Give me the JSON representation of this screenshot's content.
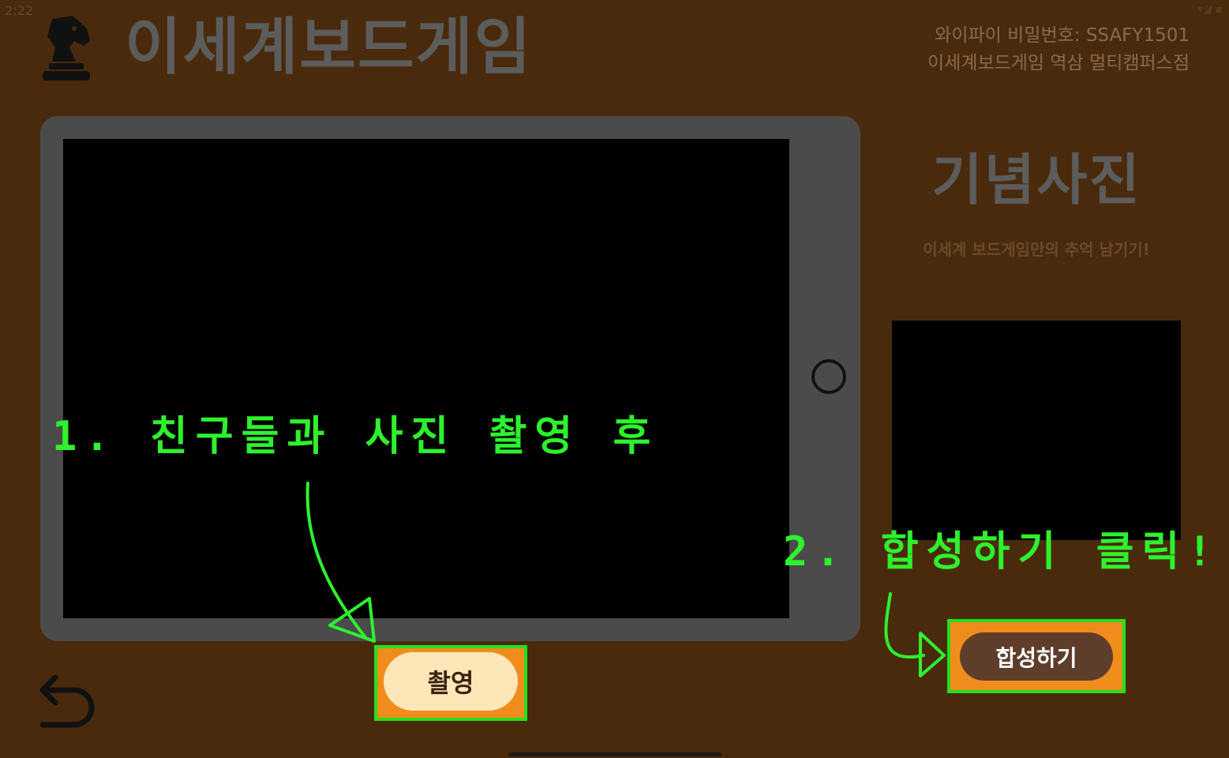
{
  "status": {
    "time": "2:22",
    "icons": "▾◢ ▪"
  },
  "header": {
    "title": "이세계보드게임",
    "wifi_line": "와이파이 비밀번호: SSAFY1501",
    "store_line": "이세계보드게임 역삼 멀티캠퍼스점"
  },
  "panel": {
    "title": "기념사진",
    "subtitle": "이세계 보드게임만의 추억 남기기!"
  },
  "buttons": {
    "shoot_label": "촬영",
    "compose_label": "합성하기"
  },
  "annotations": {
    "step1": "1. 친구들과 사진 촬영 후",
    "step2": "2. 합성하기 클릭!"
  },
  "colors": {
    "background": "#4a2a0d",
    "highlight_fill": "#f08c1c",
    "highlight_border": "#22e01c",
    "annotation": "#2df22d"
  },
  "icons": {
    "logo": "chess-knight-icon",
    "back": "undo-arrow-icon",
    "home": "home-button-icon"
  }
}
